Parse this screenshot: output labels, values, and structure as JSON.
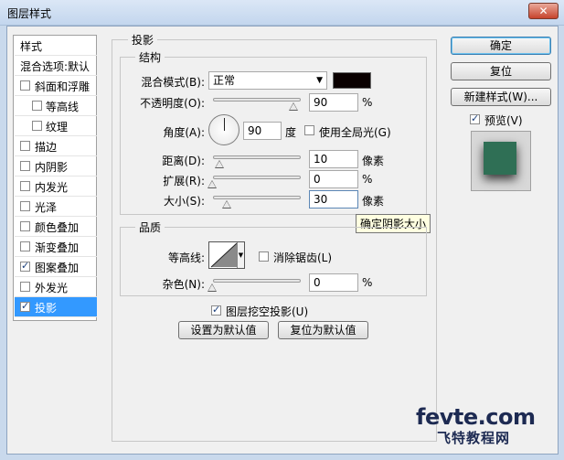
{
  "window": {
    "title": "图层样式",
    "close_glyph": "✕"
  },
  "style_list": {
    "items": [
      {
        "label": "样式",
        "kind": "header",
        "checked": false
      },
      {
        "label": "混合选项:默认",
        "kind": "header",
        "checked": false
      },
      {
        "label": "斜面和浮雕",
        "kind": "check",
        "checked": false
      },
      {
        "label": "等高线",
        "kind": "sub",
        "checked": false
      },
      {
        "label": "纹理",
        "kind": "sub",
        "checked": false
      },
      {
        "label": "描边",
        "kind": "check",
        "checked": false
      },
      {
        "label": "内阴影",
        "kind": "check",
        "checked": false
      },
      {
        "label": "内发光",
        "kind": "check",
        "checked": false
      },
      {
        "label": "光泽",
        "kind": "check",
        "checked": false
      },
      {
        "label": "颜色叠加",
        "kind": "check",
        "checked": false
      },
      {
        "label": "渐变叠加",
        "kind": "check",
        "checked": false
      },
      {
        "label": "图案叠加",
        "kind": "check",
        "checked": true
      },
      {
        "label": "外发光",
        "kind": "check",
        "checked": false
      },
      {
        "label": "投影",
        "kind": "check",
        "checked": true,
        "selected": true
      }
    ]
  },
  "drop_shadow": {
    "title": "投影",
    "structure": {
      "title": "结构",
      "blend_mode_label": "混合模式(B):",
      "blend_mode_value": "正常",
      "shadow_color": "#0a0000",
      "opacity_label": "不透明度(O):",
      "opacity_value": "90",
      "opacity_unit": "%",
      "angle_label": "角度(A):",
      "angle_value": "90",
      "angle_unit": "度",
      "global_light_label": "使用全局光(G)",
      "global_light_checked": false,
      "distance_label": "距离(D):",
      "distance_value": "10",
      "distance_unit": "像素",
      "spread_label": "扩展(R):",
      "spread_value": "0",
      "spread_unit": "%",
      "size_label": "大小(S):",
      "size_value": "30",
      "size_unit": "像素"
    },
    "quality": {
      "title": "品质",
      "contour_label": "等高线:",
      "antialias_label": "消除锯齿(L)",
      "antialias_checked": false,
      "noise_label": "杂色(N):",
      "noise_value": "0",
      "noise_unit": "%"
    },
    "knockout_label": "图层挖空投影(U)",
    "knockout_checked": true,
    "make_default_label": "设置为默认值",
    "reset_default_label": "复位为默认值"
  },
  "tooltip": "确定阴影大小",
  "buttons": {
    "ok": "确定",
    "reset": "复位",
    "new_style": "新建样式(W)...",
    "preview_label": "预览(V)",
    "preview_checked": true
  },
  "watermark": {
    "line1": "fevte.com",
    "line2": "飞特教程网"
  },
  "colors": {
    "selection": "#3399ff",
    "swatch_green": "#2f6f55"
  }
}
